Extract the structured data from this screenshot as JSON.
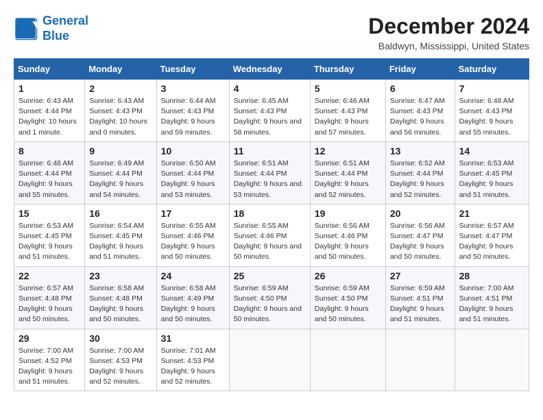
{
  "header": {
    "logo_line1": "General",
    "logo_line2": "Blue",
    "month_title": "December 2024",
    "location": "Baldwyn, Mississippi, United States"
  },
  "columns": [
    "Sunday",
    "Monday",
    "Tuesday",
    "Wednesday",
    "Thursday",
    "Friday",
    "Saturday"
  ],
  "weeks": [
    [
      {
        "day": "1",
        "sunrise": "Sunrise: 6:43 AM",
        "sunset": "Sunset: 4:44 PM",
        "daylight": "Daylight: 10 hours and 1 minute."
      },
      {
        "day": "2",
        "sunrise": "Sunrise: 6:43 AM",
        "sunset": "Sunset: 4:43 PM",
        "daylight": "Daylight: 10 hours and 0 minutes."
      },
      {
        "day": "3",
        "sunrise": "Sunrise: 6:44 AM",
        "sunset": "Sunset: 4:43 PM",
        "daylight": "Daylight: 9 hours and 59 minutes."
      },
      {
        "day": "4",
        "sunrise": "Sunrise: 6:45 AM",
        "sunset": "Sunset: 4:43 PM",
        "daylight": "Daylight: 9 hours and 58 minutes."
      },
      {
        "day": "5",
        "sunrise": "Sunrise: 6:46 AM",
        "sunset": "Sunset: 4:43 PM",
        "daylight": "Daylight: 9 hours and 57 minutes."
      },
      {
        "day": "6",
        "sunrise": "Sunrise: 6:47 AM",
        "sunset": "Sunset: 4:43 PM",
        "daylight": "Daylight: 9 hours and 56 minutes."
      },
      {
        "day": "7",
        "sunrise": "Sunrise: 6:48 AM",
        "sunset": "Sunset: 4:43 PM",
        "daylight": "Daylight: 9 hours and 55 minutes."
      }
    ],
    [
      {
        "day": "8",
        "sunrise": "Sunrise: 6:48 AM",
        "sunset": "Sunset: 4:44 PM",
        "daylight": "Daylight: 9 hours and 55 minutes."
      },
      {
        "day": "9",
        "sunrise": "Sunrise: 6:49 AM",
        "sunset": "Sunset: 4:44 PM",
        "daylight": "Daylight: 9 hours and 54 minutes."
      },
      {
        "day": "10",
        "sunrise": "Sunrise: 6:50 AM",
        "sunset": "Sunset: 4:44 PM",
        "daylight": "Daylight: 9 hours and 53 minutes."
      },
      {
        "day": "11",
        "sunrise": "Sunrise: 6:51 AM",
        "sunset": "Sunset: 4:44 PM",
        "daylight": "Daylight: 9 hours and 53 minutes."
      },
      {
        "day": "12",
        "sunrise": "Sunrise: 6:51 AM",
        "sunset": "Sunset: 4:44 PM",
        "daylight": "Daylight: 9 hours and 52 minutes."
      },
      {
        "day": "13",
        "sunrise": "Sunrise: 6:52 AM",
        "sunset": "Sunset: 4:44 PM",
        "daylight": "Daylight: 9 hours and 52 minutes."
      },
      {
        "day": "14",
        "sunrise": "Sunrise: 6:53 AM",
        "sunset": "Sunset: 4:45 PM",
        "daylight": "Daylight: 9 hours and 51 minutes."
      }
    ],
    [
      {
        "day": "15",
        "sunrise": "Sunrise: 6:53 AM",
        "sunset": "Sunset: 4:45 PM",
        "daylight": "Daylight: 9 hours and 51 minutes."
      },
      {
        "day": "16",
        "sunrise": "Sunrise: 6:54 AM",
        "sunset": "Sunset: 4:45 PM",
        "daylight": "Daylight: 9 hours and 51 minutes."
      },
      {
        "day": "17",
        "sunrise": "Sunrise: 6:55 AM",
        "sunset": "Sunset: 4:46 PM",
        "daylight": "Daylight: 9 hours and 50 minutes."
      },
      {
        "day": "18",
        "sunrise": "Sunrise: 6:55 AM",
        "sunset": "Sunset: 4:46 PM",
        "daylight": "Daylight: 9 hours and 50 minutes."
      },
      {
        "day": "19",
        "sunrise": "Sunrise: 6:56 AM",
        "sunset": "Sunset: 4:46 PM",
        "daylight": "Daylight: 9 hours and 50 minutes."
      },
      {
        "day": "20",
        "sunrise": "Sunrise: 6:56 AM",
        "sunset": "Sunset: 4:47 PM",
        "daylight": "Daylight: 9 hours and 50 minutes."
      },
      {
        "day": "21",
        "sunrise": "Sunrise: 6:57 AM",
        "sunset": "Sunset: 4:47 PM",
        "daylight": "Daylight: 9 hours and 50 minutes."
      }
    ],
    [
      {
        "day": "22",
        "sunrise": "Sunrise: 6:57 AM",
        "sunset": "Sunset: 4:48 PM",
        "daylight": "Daylight: 9 hours and 50 minutes."
      },
      {
        "day": "23",
        "sunrise": "Sunrise: 6:58 AM",
        "sunset": "Sunset: 4:48 PM",
        "daylight": "Daylight: 9 hours and 50 minutes."
      },
      {
        "day": "24",
        "sunrise": "Sunrise: 6:58 AM",
        "sunset": "Sunset: 4:49 PM",
        "daylight": "Daylight: 9 hours and 50 minutes."
      },
      {
        "day": "25",
        "sunrise": "Sunrise: 6:59 AM",
        "sunset": "Sunset: 4:50 PM",
        "daylight": "Daylight: 9 hours and 50 minutes."
      },
      {
        "day": "26",
        "sunrise": "Sunrise: 6:59 AM",
        "sunset": "Sunset: 4:50 PM",
        "daylight": "Daylight: 9 hours and 50 minutes."
      },
      {
        "day": "27",
        "sunrise": "Sunrise: 6:59 AM",
        "sunset": "Sunset: 4:51 PM",
        "daylight": "Daylight: 9 hours and 51 minutes."
      },
      {
        "day": "28",
        "sunrise": "Sunrise: 7:00 AM",
        "sunset": "Sunset: 4:51 PM",
        "daylight": "Daylight: 9 hours and 51 minutes."
      }
    ],
    [
      {
        "day": "29",
        "sunrise": "Sunrise: 7:00 AM",
        "sunset": "Sunset: 4:52 PM",
        "daylight": "Daylight: 9 hours and 51 minutes."
      },
      {
        "day": "30",
        "sunrise": "Sunrise: 7:00 AM",
        "sunset": "Sunset: 4:53 PM",
        "daylight": "Daylight: 9 hours and 52 minutes."
      },
      {
        "day": "31",
        "sunrise": "Sunrise: 7:01 AM",
        "sunset": "Sunset: 4:53 PM",
        "daylight": "Daylight: 9 hours and 52 minutes."
      },
      null,
      null,
      null,
      null
    ]
  ]
}
